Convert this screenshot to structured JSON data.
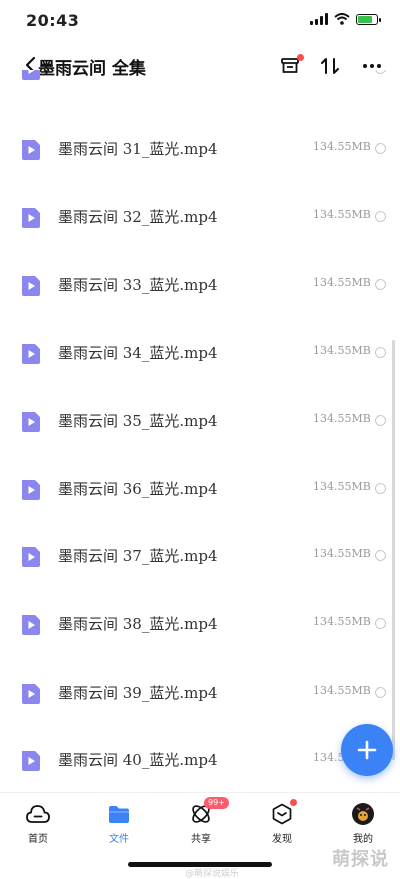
{
  "status_bar": {
    "time": "20:43",
    "battery_level": 0.75,
    "battery_color": "#39c24b"
  },
  "nav": {
    "title": "墨雨云间 全集"
  },
  "files": [
    {
      "name": "墨雨云间 31_蓝光.mp4",
      "size": "134.55MB"
    },
    {
      "name": "墨雨云间 32_蓝光.mp4",
      "size": "134.55MB"
    },
    {
      "name": "墨雨云间 33_蓝光.mp4",
      "size": "134.55MB"
    },
    {
      "name": "墨雨云间 34_蓝光.mp4",
      "size": "134.55MB"
    },
    {
      "name": "墨雨云间 35_蓝光.mp4",
      "size": "134.55MB"
    },
    {
      "name": "墨雨云间 36_蓝光.mp4",
      "size": "134.55MB"
    },
    {
      "name": "墨雨云间 37_蓝光.mp4",
      "size": "134.55MB"
    },
    {
      "name": "墨雨云间 38_蓝光.mp4",
      "size": "134.55MB"
    },
    {
      "name": "墨雨云间 39_蓝光.mp4",
      "size": "134.55MB"
    },
    {
      "name": "墨雨云间 40_蓝光.mp4",
      "size": "134.55MB"
    }
  ],
  "tabs": [
    {
      "label": "首页",
      "icon": "cloud-icon",
      "active": false
    },
    {
      "label": "文件",
      "icon": "folder-icon",
      "active": true
    },
    {
      "label": "共享",
      "icon": "share-icon",
      "active": false,
      "badge": "99+"
    },
    {
      "label": "发现",
      "icon": "discover-icon",
      "active": false,
      "dot": true
    },
    {
      "label": "我的",
      "icon": "avatar-icon",
      "active": false
    }
  ],
  "colors": {
    "accent": "#3b82f6",
    "video_icon": "#8b87ee",
    "badge": "#ff5a6a"
  },
  "watermark": {
    "main": "萌探说",
    "small": "@萌探说娱乐"
  }
}
